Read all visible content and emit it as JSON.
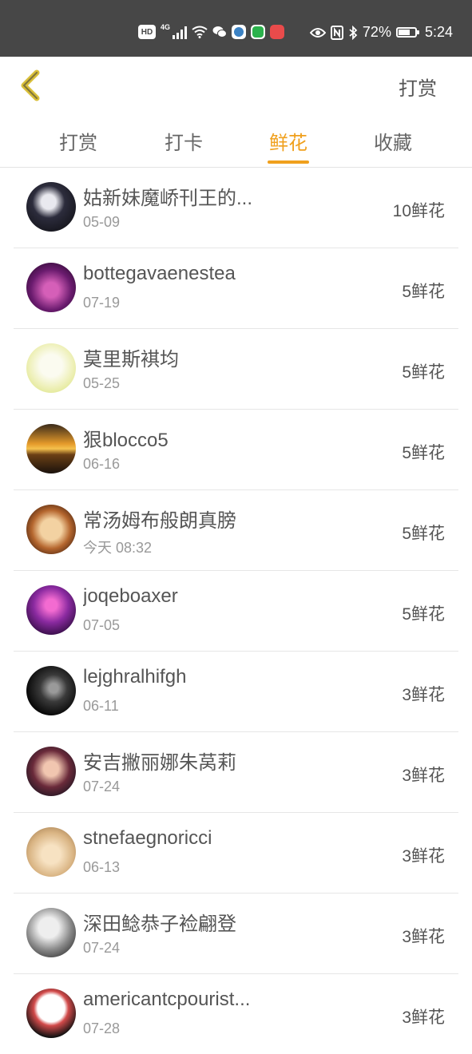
{
  "status_bar": {
    "hd_label": "HD",
    "network_label": "4G",
    "battery_percent": "72%",
    "battery_level": 0.72,
    "time": "5:24",
    "icons": [
      "hd-icon",
      "signal-icon",
      "wifi-icon",
      "wechat-icon",
      "browser-app-icon",
      "line-app-icon",
      "mail-app-icon",
      "eye-icon",
      "nfc-icon",
      "bluetooth-icon",
      "battery-icon"
    ]
  },
  "header": {
    "back_icon": "chevron-left-icon",
    "action_label": "打赏",
    "accent_color": "#f0a01d"
  },
  "tabs": [
    {
      "label": "打赏",
      "active": false
    },
    {
      "label": "打卡",
      "active": false
    },
    {
      "label": "鲜花",
      "active": true
    },
    {
      "label": "收藏",
      "active": false
    }
  ],
  "list": [
    {
      "name": "姑新妹魔峤刊王的...",
      "date": "05-09",
      "amount": "10鲜花"
    },
    {
      "name": "bottegavaenestea",
      "date": "07-19",
      "amount": "5鲜花"
    },
    {
      "name": "莫里斯褀均",
      "date": "05-25",
      "amount": "5鲜花"
    },
    {
      "name": "狠blocco5",
      "date": "06-16",
      "amount": "5鲜花"
    },
    {
      "name": "常汤姆布般朗真膀",
      "date": "今天 08:32",
      "amount": "5鲜花"
    },
    {
      "name": "joqeboaxer",
      "date": "07-05",
      "amount": "5鲜花"
    },
    {
      "name": "lejghralhifgh",
      "date": "06-11",
      "amount": "3鲜花"
    },
    {
      "name": "安吉撇丽娜朱莴莉",
      "date": "07-24",
      "amount": "3鲜花"
    },
    {
      "name": "stnefaegnoricci",
      "date": "06-13",
      "amount": "3鲜花"
    },
    {
      "name": "深田鲶恭子裣翩登",
      "date": "07-24",
      "amount": "3鲜花"
    },
    {
      "name": "americantcpourist...",
      "date": "07-28",
      "amount": "3鲜花"
    }
  ]
}
